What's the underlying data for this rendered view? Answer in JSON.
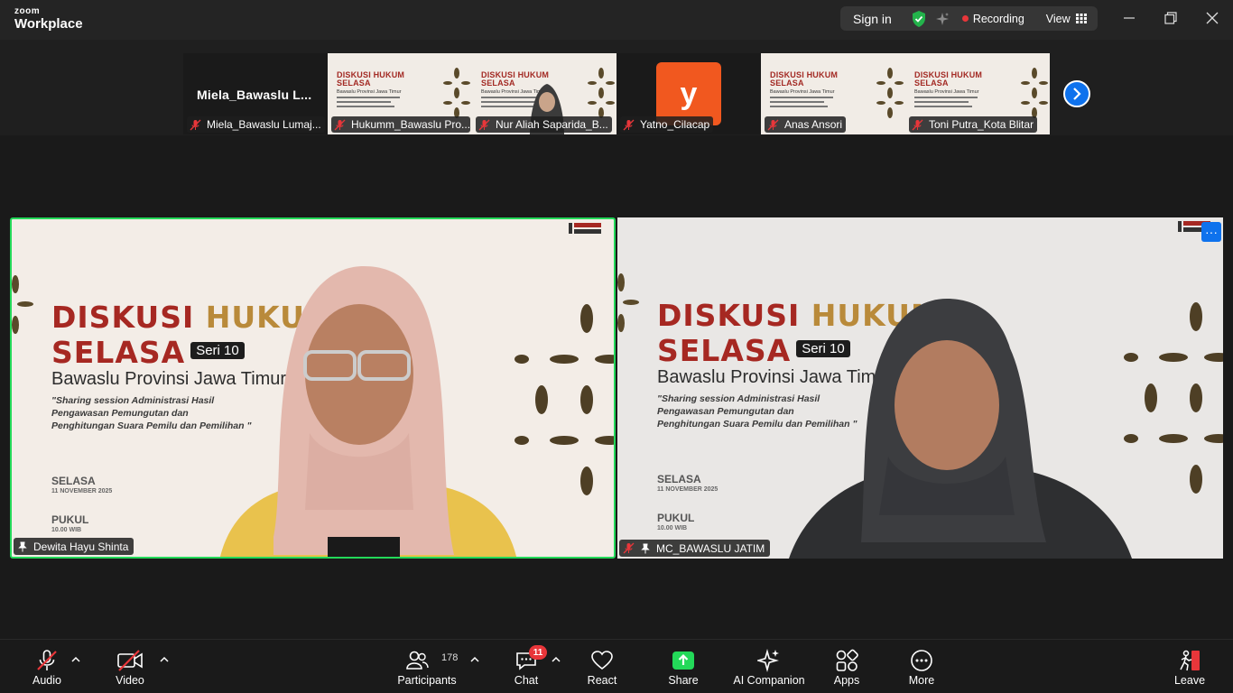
{
  "app": {
    "logo_top": "zoom",
    "logo_main": "Workplace"
  },
  "titlebar": {
    "sign_in": "Sign in",
    "recording": "Recording",
    "view": "View"
  },
  "strip": {
    "tiles": [
      {
        "kind": "name",
        "big_name": "Miela_Bawaslu  L...",
        "label": "Miela_Bawaslu Lumaj..."
      },
      {
        "kind": "slide",
        "label": "Hukumm_Bawaslu Pro..."
      },
      {
        "kind": "slide-person",
        "label": "Nur Aliah Saparida_B..."
      },
      {
        "kind": "avatar",
        "avatar_letter": "y",
        "label": "Yatno_Cilacap"
      },
      {
        "kind": "slide",
        "label": "Anas Ansori"
      },
      {
        "kind": "slide",
        "label": "Toni Putra_Kota Blitar"
      }
    ],
    "mini_title_1": "DISKUSI HUKUM",
    "mini_title_2": "SELASA",
    "mini_sub": "Bawaslu Provinsi Jawa Timur"
  },
  "slide": {
    "title_line1_red": "DISKUSI ",
    "title_line1_gold": "HUKUM",
    "title_line2": "SELASA",
    "seri": "Seri 10",
    "subtitle": "Bawaslu Provinsi Jawa Timur",
    "quote_line1": "\"Sharing session Administrasi Hasil",
    "quote_line2": "Pengawasan Pemungutan dan",
    "quote_line3": "Penghitungan Suara Pemilu dan Pemilihan \"",
    "day_label": "SELASA",
    "date": "11 NOVEMBER 2025",
    "time_label": "PUKUL",
    "time": "10.00 WIB"
  },
  "main_tiles": {
    "left_name": "Dewita Hayu Shinta",
    "right_name": "MC_BAWASLU JATIM",
    "more": "···"
  },
  "toolbar": {
    "audio": "Audio",
    "video": "Video",
    "participants": "Participants",
    "participants_count": "178",
    "chat": "Chat",
    "chat_badge": "11",
    "react": "React",
    "share": "Share",
    "ai_companion": "AI Companion",
    "apps": "Apps",
    "more": "More",
    "leave": "Leave"
  },
  "colors": {
    "accent_blue": "#0e72ed",
    "active_speaker": "#23d959",
    "recording": "#e8363a",
    "share_green": "#23d959",
    "avatar_orange": "#f1581f"
  }
}
